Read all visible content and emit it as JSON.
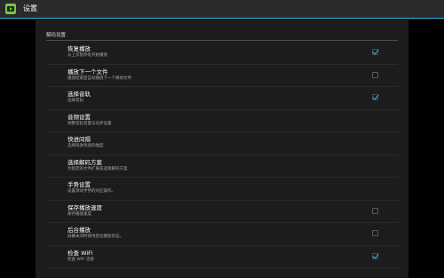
{
  "app": {
    "title": "设置",
    "icon": "video-player-app-icon",
    "accent_color": "#33b5e5"
  },
  "section": {
    "header": "解码设置"
  },
  "preferences": [
    {
      "title": "恢复播放",
      "summary": "从上次暂停处开始播放",
      "checkbox": true,
      "checked": true
    },
    {
      "title": "播放下一个文件",
      "summary": "播放结束后自动播放下一个媒体文件",
      "checkbox": true,
      "checked": false
    },
    {
      "title": "选择音轨",
      "summary": "选择音轨",
      "checkbox": true,
      "checked": true
    },
    {
      "title": "音频设置",
      "summary": "调整音轨音量与同步设置",
      "checkbox": false,
      "checked": false
    },
    {
      "title": "快进间隔",
      "summary": "选择快进快退的幅度",
      "checkbox": false,
      "checked": false
    },
    {
      "title": "选择解码方案",
      "summary": "为指定的文件扩展名选择解码方案",
      "checkbox": false,
      "checked": false
    },
    {
      "title": "手势设置",
      "summary": "设置滑动手势的对应操作。",
      "checkbox": false,
      "checked": false
    },
    {
      "title": "保存播放速度",
      "summary": "保存播放速度",
      "checkbox": true,
      "checked": false
    },
    {
      "title": "后台播放",
      "summary": "屏幕关闭时保持后台播放状态。",
      "checkbox": true,
      "checked": false
    },
    {
      "title": "检查 WiFi",
      "summary": "检查 WiFi 连接",
      "checkbox": true,
      "checked": true
    }
  ]
}
